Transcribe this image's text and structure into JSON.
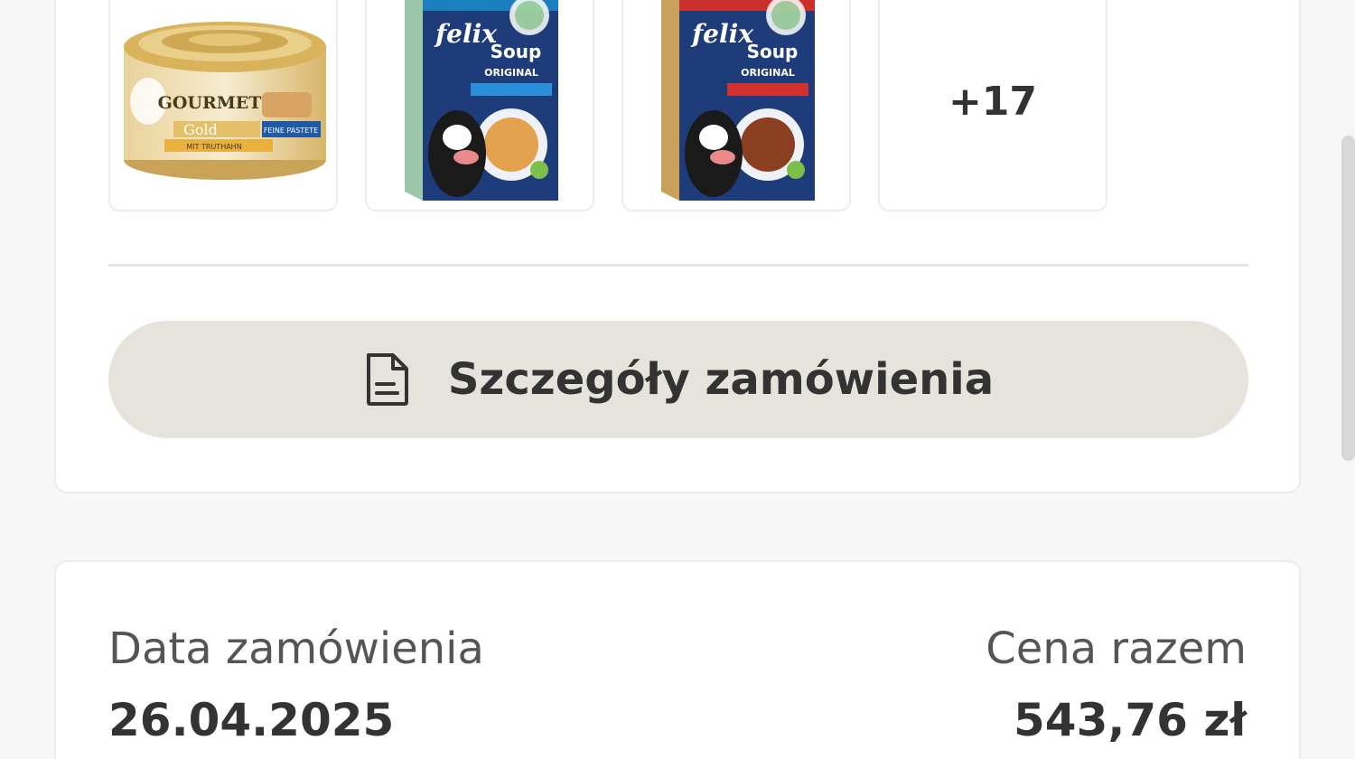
{
  "order": {
    "thumbnails": [
      {
        "name": "Purina Gourmet Gold Feine Pastete mit Truthahn",
        "brand_text": "GOURMET",
        "sub_text": "Gold",
        "tag_text": "FEINE PASTETE",
        "flavor_text": "MIT TRUTHAHN"
      },
      {
        "name": "Purina Felix Soup Original (blue pack)",
        "brand_text": "felix",
        "sub_text": "Soup",
        "tag_text": "ORIGINAL"
      },
      {
        "name": "Purina Felix Soup Original (red pack)",
        "brand_text": "felix",
        "sub_text": "Soup",
        "tag_text": "ORIGINAL"
      }
    ],
    "more_count": "+17",
    "details_button_label": "Szczegóły zamówienia",
    "details_button_icon": "document-icon",
    "date_label": "Data zamówienia",
    "date_value": "26.04.2025",
    "total_label": "Cena razem",
    "total_value": "543,76 zł"
  },
  "colors": {
    "button_bg": "#e6e2dc",
    "text_primary": "#333333",
    "card_border": "#ececec",
    "felix_blue": "#1f3c7a",
    "felix_red_accent": "#c9302c",
    "gourmet_gold": "#d9b25c"
  }
}
